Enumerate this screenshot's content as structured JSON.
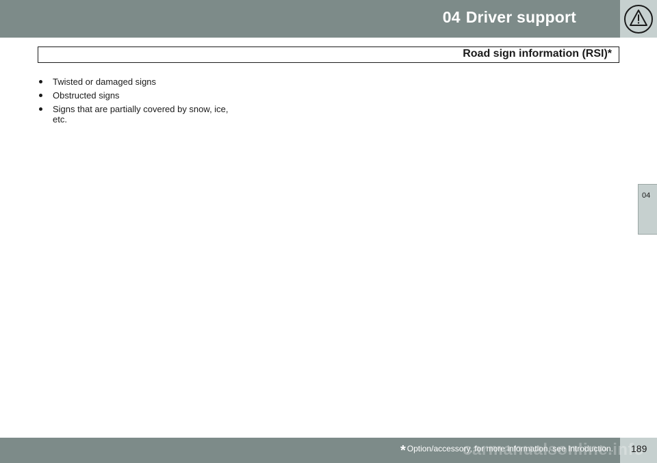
{
  "header": {
    "chapter_number": "04",
    "chapter_title": "Driver support",
    "icon": "warning-triangle-icon"
  },
  "section": {
    "title": "Road sign information (RSI)*"
  },
  "content": {
    "bullets": [
      "Twisted or damaged signs",
      "Obstructed signs",
      "Signs that are partially covered by snow, ice, etc."
    ]
  },
  "side_tab": {
    "label": "04"
  },
  "footer": {
    "asterisk": "*",
    "note": "Option/accessory, for more information, see Introduction.",
    "page_number": "189",
    "watermark": "carmanualsonline.info"
  },
  "colors": {
    "band": "#7d8b89",
    "light_band": "#c6d0cf",
    "text": "#1a1a1a"
  }
}
